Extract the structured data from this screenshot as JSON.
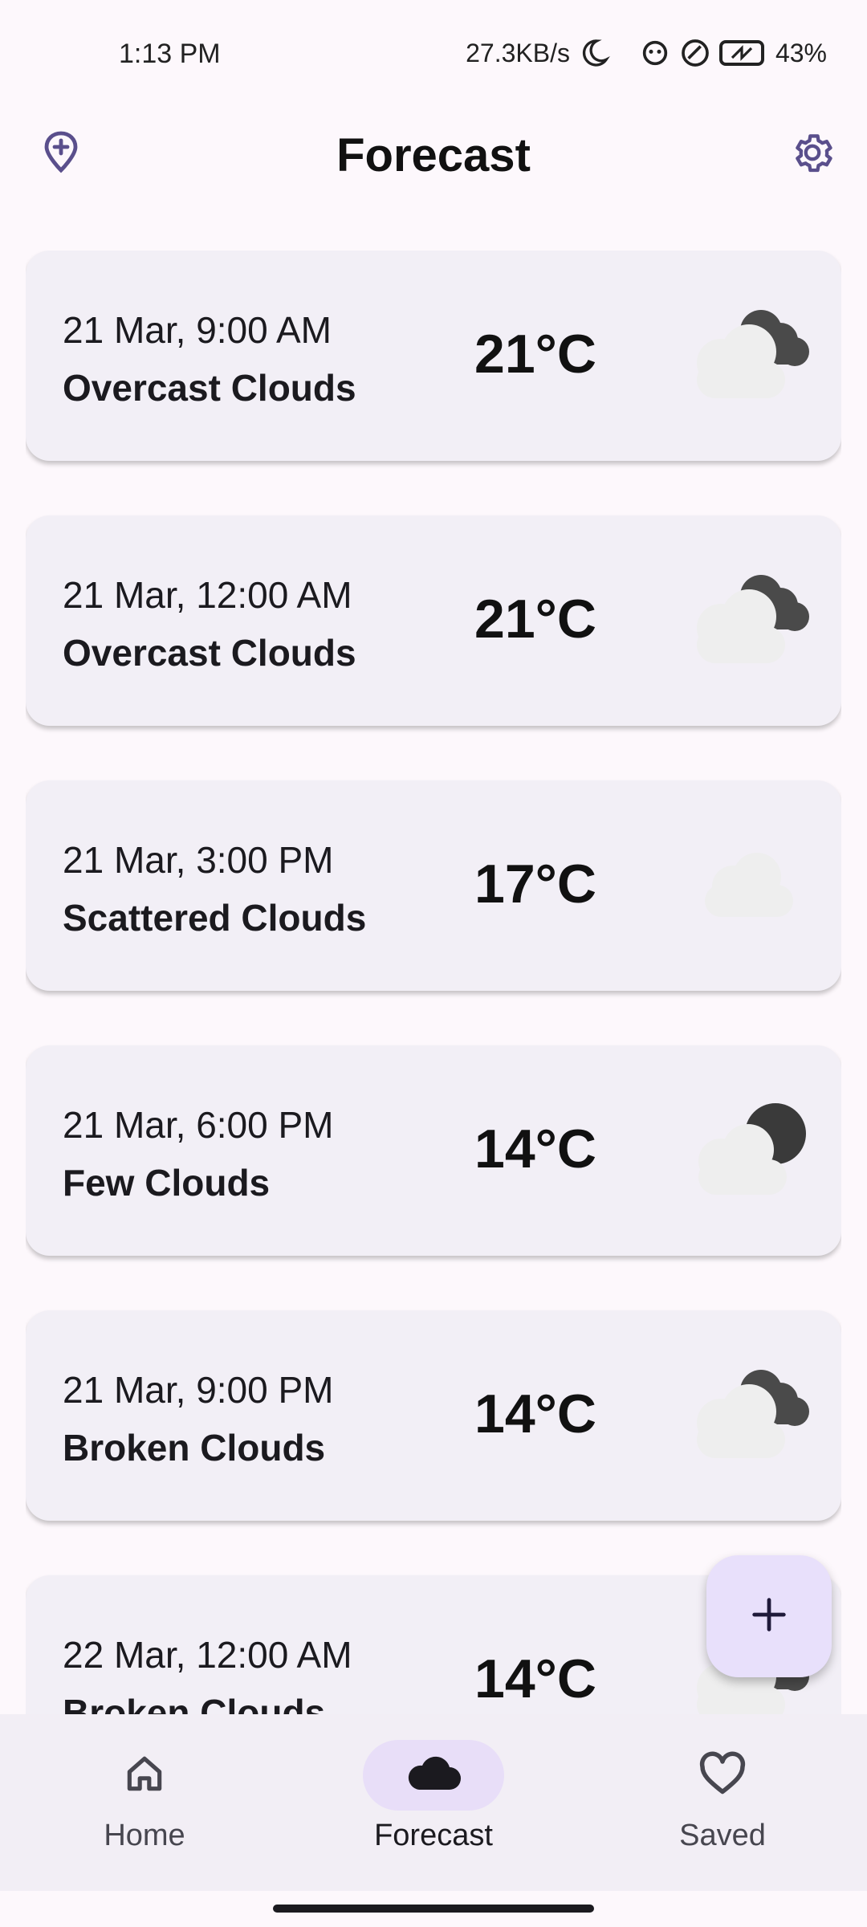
{
  "status_bar": {
    "time": "1:13 PM",
    "network_speed": "27.3KB/s",
    "battery": "43%"
  },
  "header": {
    "title": "Forecast",
    "left_icon": "add-location-icon",
    "right_icon": "gear-icon"
  },
  "forecast": {
    "items": [
      {
        "date": "21 Mar, 9:00 AM",
        "description": "Overcast Clouds",
        "temp": "21°C",
        "icon": "overcast-clouds-icon"
      },
      {
        "date": "21 Mar, 12:00 AM",
        "description": "Overcast Clouds",
        "temp": "21°C",
        "icon": "overcast-clouds-icon"
      },
      {
        "date": "21 Mar, 3:00 PM",
        "description": "Scattered Clouds",
        "temp": "17°C",
        "icon": "scattered-clouds-icon"
      },
      {
        "date": "21 Mar, 6:00 PM",
        "description": "Few Clouds",
        "temp": "14°C",
        "icon": "few-clouds-icon"
      },
      {
        "date": "21 Mar, 9:00 PM",
        "description": "Broken Clouds",
        "temp": "14°C",
        "icon": "broken-clouds-icon"
      },
      {
        "date": "22 Mar, 12:00 AM",
        "description": "Broken Clouds",
        "temp": "14°C",
        "icon": "broken-clouds-icon"
      }
    ]
  },
  "fab": {
    "icon": "plus-icon"
  },
  "bottom_nav": {
    "items": [
      {
        "label": "Home",
        "icon": "home-icon",
        "selected": false
      },
      {
        "label": "Forecast",
        "icon": "cloud-icon",
        "selected": true
      },
      {
        "label": "Saved",
        "icon": "heart-icon",
        "selected": false
      }
    ]
  },
  "colors": {
    "background": "#fdf8fc",
    "card": "#f2eff6",
    "accent": "#5a4f8c",
    "fab": "#e8e0fb",
    "nav_indicator": "#e8def8"
  }
}
